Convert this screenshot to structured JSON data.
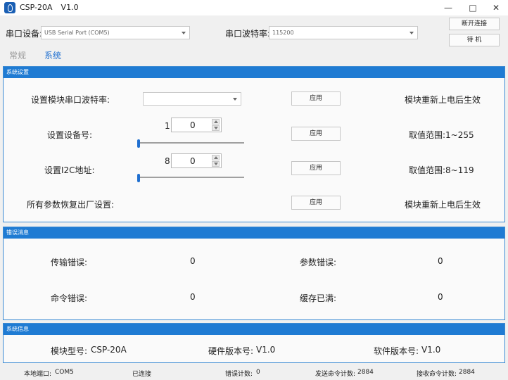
{
  "window": {
    "title": "CSP-20A",
    "version": "V1.0"
  },
  "toolbar": {
    "port_label": "串口设备:",
    "port_value": "USB Serial Port (COM5)",
    "baud_label": "串口波特率:",
    "baud_value": "115200",
    "disconnect_label": "断开连接",
    "standby_label": "待 机"
  },
  "tabs": [
    {
      "label": "常规"
    },
    {
      "label": "系统"
    }
  ],
  "system_settings": {
    "header": "系统设置",
    "rows": [
      {
        "label": "设置模块串口波特率:",
        "apply": "应用",
        "note": "模块重新上电后生效"
      },
      {
        "label": "设置设备号:",
        "slider_value": "1",
        "spin_value": "0",
        "apply": "应用",
        "note": "取值范围:1~255"
      },
      {
        "label": "设置I2C地址:",
        "slider_value": "8",
        "spin_value": "0",
        "apply": "应用",
        "note": "取值范围:8~119"
      },
      {
        "label": "所有参数恢复出厂设置:",
        "apply": "应用",
        "note": "模块重新上电后生效"
      }
    ]
  },
  "error_info": {
    "header": "错误消息",
    "transfer_error_label": "传输错误:",
    "transfer_error_value": "0",
    "param_error_label": "参数错误:",
    "param_error_value": "0",
    "command_error_label": "命令错误:",
    "command_error_value": "0",
    "buffer_full_label": "缓存已满:",
    "buffer_full_value": "0"
  },
  "system_info": {
    "header": "系统信息",
    "model_label": "模块型号:",
    "model_value": "CSP-20A",
    "hw_label": "硬件版本号:",
    "hw_value": "V1.0",
    "sw_label": "软件版本号:",
    "sw_value": "V1.0"
  },
  "status": {
    "local_port_label": "本地端口:",
    "local_port_value": "COM5",
    "connected": "已连接",
    "error_count_label": "错误计数:",
    "error_count_value": "0",
    "sent_label": "发送命令计数:",
    "sent_value": "2884",
    "recv_label": "接收命令计数:",
    "recv_value": "2884"
  },
  "colors": {
    "accent": "#1f7bd3",
    "panel_border": "#3b8ad3"
  }
}
